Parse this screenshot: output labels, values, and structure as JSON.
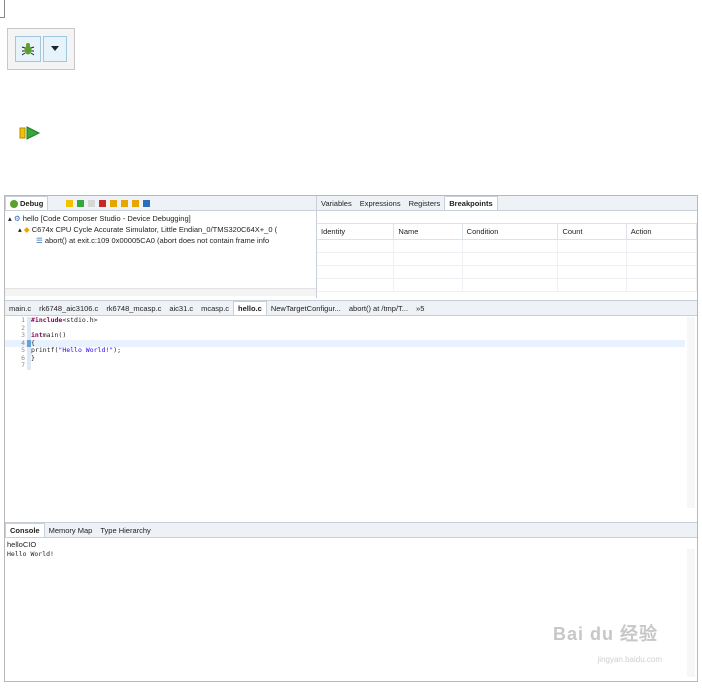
{
  "debug_panel": {
    "tab_label": "Debug",
    "tree": [
      "hello [Code Composer Studio - Device Debugging]",
      "C674x CPU Cycle Accurate Simulator, Little Endian_0/TMS320C64X+_0 (",
      "abort() at exit.c:109 0x00005CA0  (abort does not contain frame info"
    ]
  },
  "breakpoints_panel": {
    "tabs": [
      "Variables",
      "Expressions",
      "Registers",
      "Breakpoints"
    ],
    "columns": [
      "Identity",
      "Name",
      "Condition",
      "Count",
      "Action"
    ]
  },
  "editor": {
    "tabs": [
      "main.c",
      "rk6748_aic3106.c",
      "rk6748_mcasp.c",
      "aic31.c",
      "mcasp.c",
      "hello.c",
      "NewTargetConfigur...",
      "abort() at /tmp/T...",
      "»5"
    ],
    "line_numbers": [
      "1",
      "2",
      "3",
      "4",
      "5",
      "6",
      "7"
    ],
    "lines": [
      {
        "kw": "#include",
        "rest": " <stdio.h>"
      },
      {
        "kw": "",
        "rest": ""
      },
      {
        "kw": "int",
        "rest": " main()"
      },
      {
        "kw": "",
        "rest": "{"
      },
      {
        "kw": "",
        "rest": "  printf(",
        "str": "\"Hello World!\"",
        "tail": ");"
      },
      {
        "kw": "",
        "rest": "}"
      },
      {
        "kw": "",
        "rest": ""
      }
    ]
  },
  "console_panel": {
    "tabs": [
      "Console",
      "Memory Map",
      "Type Hierarchy"
    ],
    "process_name": "helloCIO",
    "output": "Hello World!"
  },
  "watermark": {
    "brand": "Bai du 经验",
    "url": "jingyan.baidu.com"
  },
  "colors": {
    "accent": "#2a6ebb",
    "keyword": "#7f0055",
    "string": "#2a00ff",
    "tab_bg": "#eef2f7"
  }
}
